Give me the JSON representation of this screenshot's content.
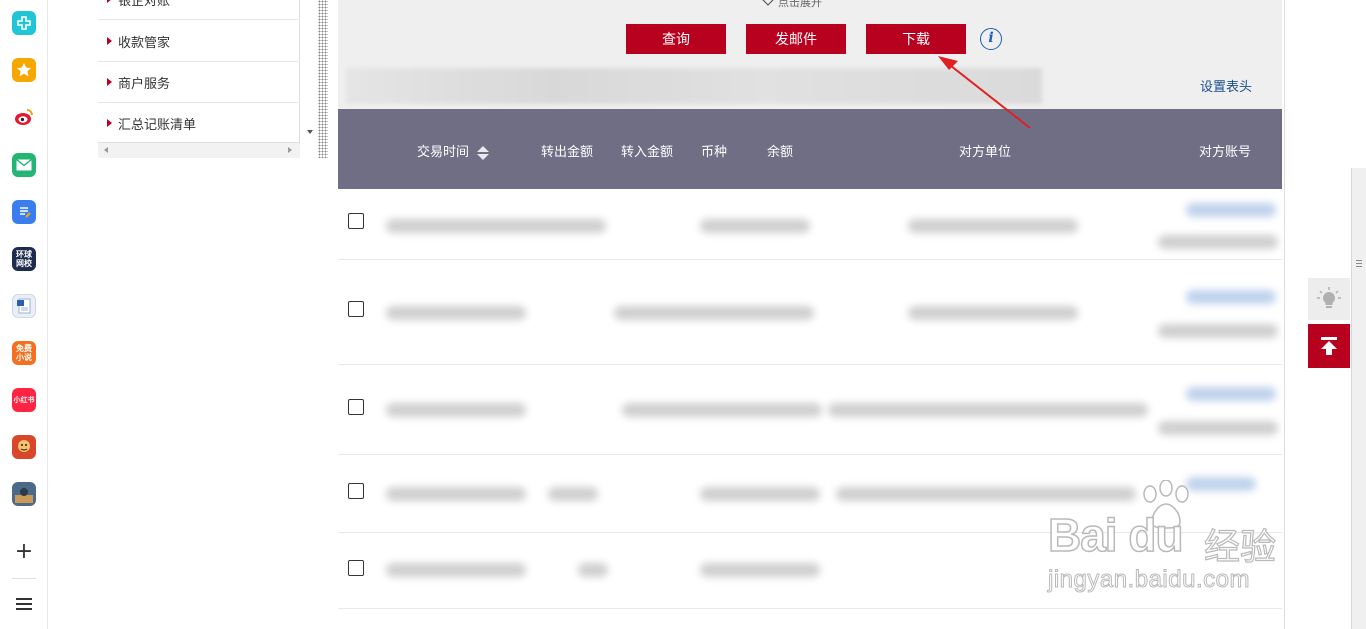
{
  "dock": {
    "icons": [
      {
        "name": "app-green-plus-icon",
        "color": "#20c5d6"
      },
      {
        "name": "app-star-icon",
        "color": "#f6a800"
      },
      {
        "name": "app-weibo-icon",
        "color": "#e6162d"
      },
      {
        "name": "app-mail-icon",
        "color": "#22b573"
      },
      {
        "name": "app-doc-icon",
        "color": "#3a7df0"
      },
      {
        "name": "app-huanqiu-icon",
        "color": "#1d2b4f",
        "text": "环球网校"
      },
      {
        "name": "app-word-icon",
        "color": "#e9eef7"
      },
      {
        "name": "app-free-novel-icon",
        "color": "#f37021",
        "text": "免费小说"
      },
      {
        "name": "app-xiaohongshu-icon",
        "color": "#ff2442",
        "text": "小红书"
      },
      {
        "name": "app-game-icon",
        "color": "#d9472b"
      },
      {
        "name": "app-pubg-icon",
        "color": "#4b6a8a"
      }
    ]
  },
  "menu": {
    "items": [
      {
        "label": "收款管家"
      },
      {
        "label": "商户服务"
      },
      {
        "label": "汇总记账清单"
      }
    ],
    "partial_top_label": "银企对账"
  },
  "toolbar": {
    "expand_label": "点击展开",
    "query_label": "查询",
    "email_label": "发邮件",
    "download_label": "下载",
    "info_glyph": "i",
    "settings_link": "设置表头"
  },
  "table": {
    "headers": [
      "交易时间",
      "转出金额",
      "转入金额",
      "币种",
      "余额",
      "对方单位",
      "对方账号"
    ]
  },
  "watermark": {
    "brand": "Bai du",
    "brand_cn": "经验",
    "url": "jingyan.baidu.com"
  },
  "colors": {
    "accent": "#b8001f",
    "header_bg": "#706e85",
    "link": "#1a4f8a"
  }
}
